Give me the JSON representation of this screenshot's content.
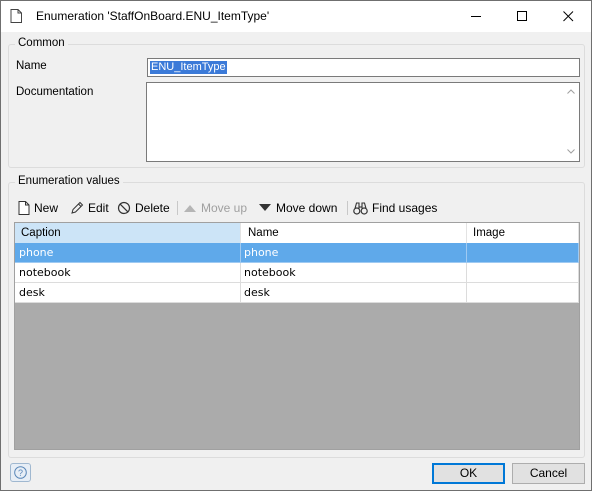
{
  "window": {
    "title": "Enumeration 'StaffOnBoard.ENU_ItemType'"
  },
  "common": {
    "legend": "Common",
    "name_label": "Name",
    "name_value": "ENU_ItemType",
    "documentation_label": "Documentation",
    "documentation_value": ""
  },
  "enum_values": {
    "legend": "Enumeration values",
    "toolbar": {
      "new": "New",
      "edit": "Edit",
      "delete": "Delete",
      "move_up": "Move up",
      "move_down": "Move down",
      "find_usages": "Find usages"
    },
    "columns": [
      "Caption",
      "Name",
      "Image"
    ],
    "rows": [
      {
        "caption": "phone",
        "name": "phone",
        "image": "",
        "selected": true
      },
      {
        "caption": "notebook",
        "name": "notebook",
        "image": "",
        "selected": false
      },
      {
        "caption": "desk",
        "name": "desk",
        "image": "",
        "selected": false
      }
    ]
  },
  "footer": {
    "ok": "OK",
    "cancel": "Cancel"
  },
  "colors": {
    "selected_row": "#5fa9ea",
    "selected_header": "#cce4f7",
    "text_selection": "#3b7ad8",
    "empty_grid": "#ababab"
  }
}
